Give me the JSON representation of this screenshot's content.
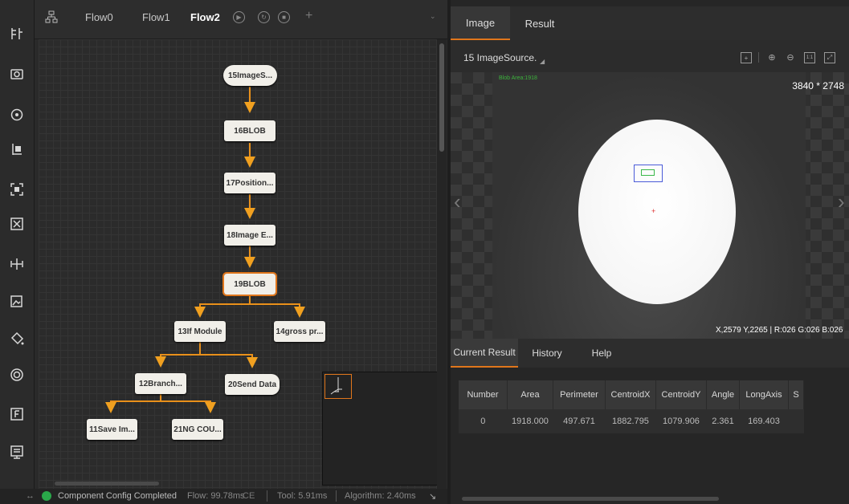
{
  "flow_tabs": {
    "items": [
      "Flow0",
      "Flow1",
      "Flow2"
    ],
    "active": "Flow2",
    "add_label": "+"
  },
  "nodes": {
    "n15": "15ImageS...",
    "n16": "16BLOB",
    "n17": "17Position...",
    "n18": "18Image E...",
    "n19": "19BLOB",
    "n13": "13If Module",
    "n14": "14gross pr...",
    "n12": "12Branch...",
    "n20": "20Send Data",
    "n11": "11Save Im...",
    "n21": "21NG COU..."
  },
  "status": {
    "message": "Component Config Completed",
    "flow": "Flow: 99.78ms",
    "flow_suffix": "CE",
    "tool": "Tool: 5.91ms",
    "algorithm": "Algorithm: 2.40ms"
  },
  "right_tabs": {
    "items": [
      "Image",
      "Result"
    ],
    "active": "Image"
  },
  "image": {
    "title": "15 ImageSource.",
    "blob_label": "Blob Area:1918",
    "resolution": "3840 * 2748",
    "coords": "X,2579  Y,2265  |  R:026  G:026  B:026"
  },
  "result_tabs": {
    "items": [
      "Current Result",
      "History",
      "Help"
    ],
    "active": "Current Result"
  },
  "results_table": {
    "columns": [
      "Number",
      "Area",
      "Perimeter",
      "CentroidX",
      "CentroidY",
      "Angle",
      "LongAxis",
      "S"
    ],
    "rows": [
      [
        "0",
        "1918.000",
        "497.671",
        "1882.795",
        "1079.906",
        "2.361",
        "169.403",
        ""
      ]
    ]
  },
  "colors": {
    "accent": "#e0761b",
    "background": "#1e1e1e",
    "status_ok": "#2aa84a",
    "blob_box": "#4a5bd8",
    "blob_green": "#3db33d"
  },
  "icons": {
    "toolbar": [
      "acquisition-icon",
      "camera-icon",
      "positioning-icon",
      "measurement-icon",
      "recognition-icon",
      "defect-detection-icon",
      "calibration-icon",
      "image-processing-icon",
      "color-icon",
      "communication-icon",
      "logic-icon",
      "calculation-icon"
    ],
    "image_tools": [
      "fit-icon",
      "zoom-in-icon",
      "zoom-out-icon",
      "actual-size-icon",
      "fullscreen-icon"
    ]
  }
}
